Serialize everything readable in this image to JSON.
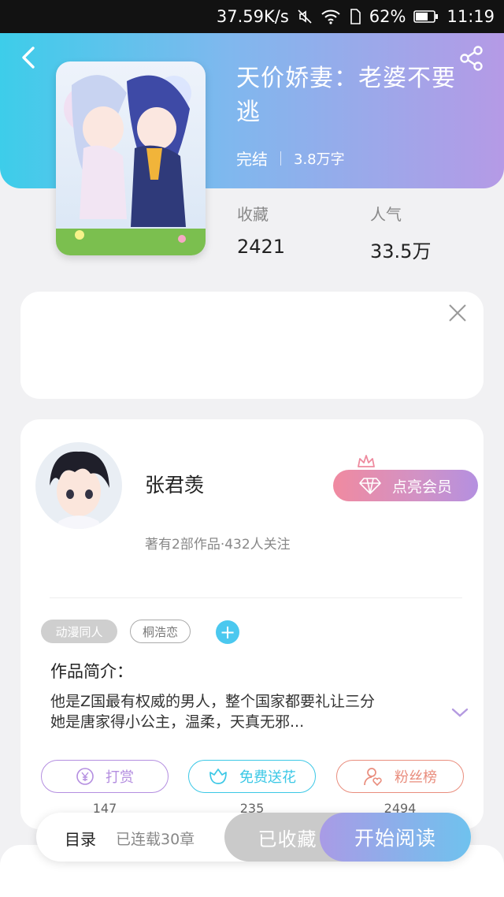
{
  "status_bar": {
    "speed": "37.59K/s",
    "battery": "62%",
    "time": "11:19"
  },
  "book": {
    "title": "天价娇妻：老婆不要逃",
    "status": "完结",
    "word_count": "3.8万字",
    "stats": {
      "favorites_label": "收藏",
      "favorites_value": "2421",
      "popularity_label": "人气",
      "popularity_value": "33.5万"
    }
  },
  "author": {
    "name": "张君羡",
    "summary": "著有2部作品·432人关注",
    "vip_label": "点亮会员"
  },
  "tags": [
    "动漫同人",
    "桐浩恋"
  ],
  "intro": {
    "title": "作品简介：",
    "line1": "他是Z国最有权威的男人，整个国家都要礼让三分",
    "line2": "她是唐家得小公主，温柔，天真无邪..."
  },
  "actions": {
    "tip": {
      "label": "打赏",
      "count": "147",
      "color": "#b48ee0"
    },
    "flower": {
      "label": "免费送花",
      "count": "235",
      "color": "#3cc8e6"
    },
    "fans": {
      "label": "粉丝榜",
      "count": "2494",
      "color": "#e98d7d"
    }
  },
  "bottom_bar": {
    "toc_label": "目录",
    "toc_sub": "已连载30章",
    "favorited_label": "已收藏",
    "read_label": "开始阅读"
  },
  "colors": {
    "hero_start": "#3dcdea",
    "hero_end": "#b59ae6",
    "accent_blue": "#4bc8ef"
  }
}
